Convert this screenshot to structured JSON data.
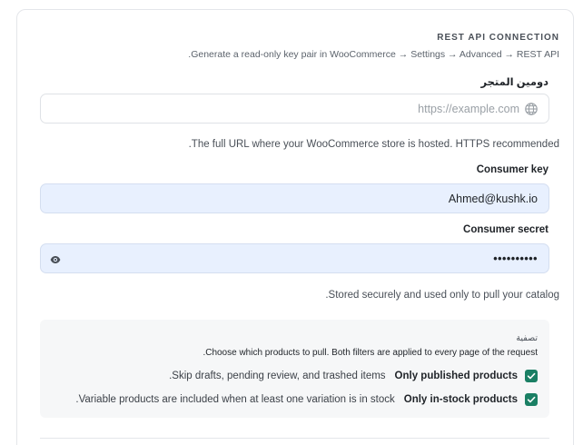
{
  "section": {
    "title": "REST API CONNECTION",
    "description": ".Generate a read-only key pair in WooCommerce → Settings → Advanced → REST API"
  },
  "store_domain": {
    "label": "دومين المتجر",
    "placeholder": "https://example.com",
    "value": "",
    "help": ".The full URL where your WooCommerce store is hosted. HTTPS recommended"
  },
  "consumer_key": {
    "label": "Consumer key",
    "value": "Ahmed@kushk.io"
  },
  "consumer_secret": {
    "label": "Consumer secret",
    "value": "••••••••••",
    "help": ".Stored securely and used only to pull your catalog"
  },
  "filters": {
    "title": "تصفية",
    "description": ".Choose which products to pull. Both filters are applied to every page of the request",
    "items": [
      {
        "label": "Only published products",
        "description": ".Skip drafts, pending review, and trashed items",
        "checked": true
      },
      {
        "label": "Only in-stock products",
        "description": ".Variable products are included when at least one variation is in stock",
        "checked": true
      }
    ]
  },
  "colors": {
    "checkbox": "#1a7f64",
    "autofill_bg": "#e8f0fe"
  },
  "icons": {
    "store_url": "globe-icon",
    "secret_toggle": "eye-icon",
    "checkbox": "check-icon"
  }
}
